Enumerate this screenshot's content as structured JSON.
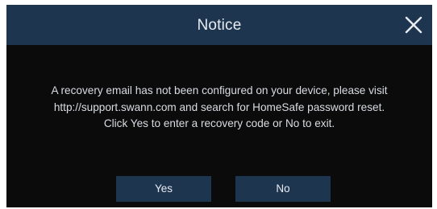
{
  "dialog": {
    "title": "Notice",
    "close_icon": "close-icon",
    "message_lines": [
      "A recovery email has not been configured on your device, please visit",
      "http://support.swann.com and search for HomeSafe password reset.",
      "Click Yes to enter a recovery code or No to exit."
    ],
    "buttons": {
      "yes_label": "Yes",
      "no_label": "No"
    }
  },
  "colors": {
    "titlebar": "#1e3550",
    "body": "#0b0b0c",
    "text": "#d9dde2",
    "button": "#1e3550"
  }
}
